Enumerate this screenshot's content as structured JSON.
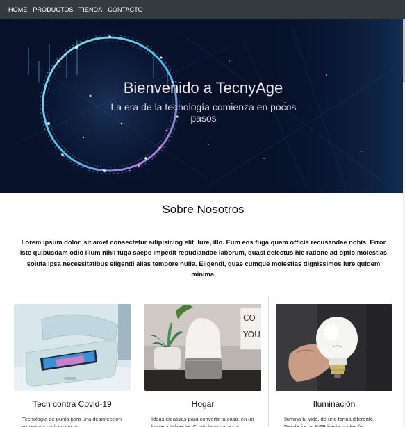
{
  "nav": {
    "items": [
      {
        "label": "HOME"
      },
      {
        "label": "PRODUCTOS"
      },
      {
        "label": "TIENDA"
      },
      {
        "label": "CONTACTO"
      }
    ]
  },
  "hero": {
    "title": "Bienvenido a TecnyAge",
    "subtitle": "La era de la tecnología comienza en pocos pasos"
  },
  "about": {
    "title": "Sobre Nosotros",
    "text": "Lorem ipsum dolor, sit amet consectetur adipisicing elit. Iure, illo. Eum eos fuga quam officia recusandae nobis. Error iste quibusdam odio illum nihil fuga saepe impedit repudiandae laborum, quasi delectus hic ratione ad optio molestias soluta ipsa necessitatibus eligendi alias tempore nulla. Eligendi, quae cumque molestias dignissimos iure quidem minima."
  },
  "cards": [
    {
      "title": "Tech contra Covid-19",
      "desc": "Tecnología de punta para una desinfección extrema y un bajo costo",
      "icon": "uv-sanitizer-image"
    },
    {
      "title": "Hogar",
      "desc": "Ideas creativas para convertir tu casa, en un hogar inteligente. Controla tu casa con",
      "icon": "smart-speaker-image"
    },
    {
      "title": "Iluminación",
      "desc": "Ilumina tu vida, de una forma diferente. Desde focos RGB hasta pocket fun",
      "icon": "led-bulb-image"
    }
  ],
  "colors": {
    "navbar": "#343a40",
    "hero_background": "#0a1730",
    "accent_cyan": "#6fe3ff",
    "accent_magenta": "#c04bd0"
  }
}
